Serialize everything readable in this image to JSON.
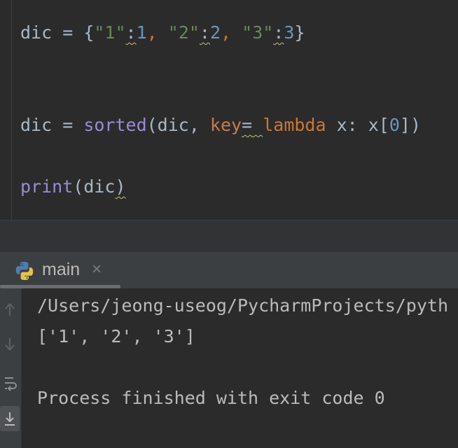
{
  "editor": {
    "line1": {
      "var": "dic",
      "eq": " = ",
      "ob": "{",
      "k1": "\"1\"",
      "c1": ":",
      "v1": "1",
      "s1": ", ",
      "k2": "\"2\"",
      "c2": ":",
      "v2": "2",
      "s2": ", ",
      "k3": "\"3\"",
      "c3": ":",
      "v3": "3",
      "cb": "}"
    },
    "line2": {
      "var": "dic",
      "eq": " = ",
      "fn": "sorted",
      "open": "(dic, ",
      "param": "key",
      "peq": "=",
      "sp": " ",
      "kw": "lambda",
      "rest1": " x: x[",
      "idx": "0",
      "close": "])"
    },
    "line3": {
      "fn": "print",
      "open": "(dic",
      "close": ")"
    }
  },
  "run_window": {
    "tab_label": "main",
    "tab_close": "×",
    "tab_icon": "python-icon"
  },
  "console": {
    "path": "/Users/jeong-useog/PycharmProjects/pyth",
    "result": "['1', '2', '3']",
    "exit_message": "Process finished with exit code 0"
  },
  "colors": {
    "background": "#2b2b2b",
    "string": "#6a8759",
    "number": "#6897bb",
    "builtin": "#9b8bd4",
    "keyword": "#cc7832"
  }
}
